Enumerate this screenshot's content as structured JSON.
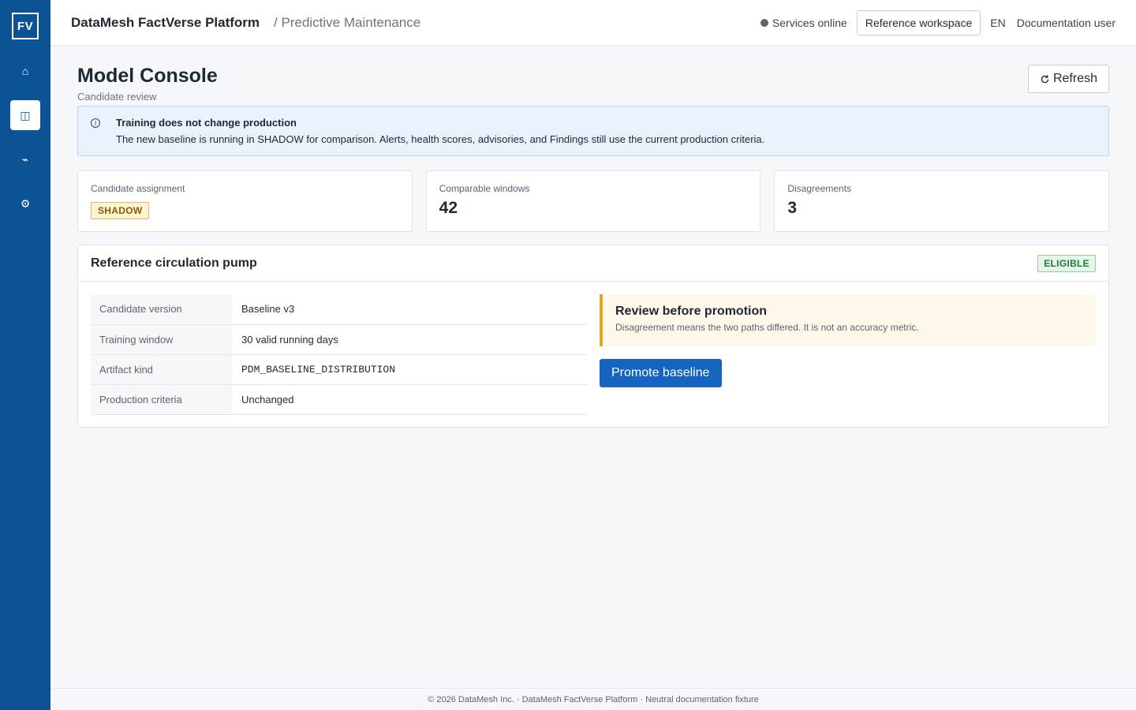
{
  "sidebar": {
    "logo": "FV",
    "items": [
      {
        "icon": "home-icon",
        "glyph": "⌂"
      },
      {
        "icon": "model-console-icon",
        "glyph": "◫"
      },
      {
        "icon": "signal-icon",
        "glyph": "⌁"
      },
      {
        "icon": "gear-icon",
        "glyph": "⚙"
      }
    ],
    "active_color": "#0b5394"
  },
  "header": {
    "brand": "DataMesh FactVerse Platform",
    "breadcrumb": "/ Predictive Maintenance",
    "status": "Services online",
    "workspace_button": "Reference workspace",
    "language": "EN",
    "user": "Documentation user"
  },
  "page": {
    "title": "Model Console",
    "subtitle": "Candidate review",
    "refresh_label": "Refresh"
  },
  "info": {
    "title": "Training does not change production",
    "text": "The new baseline is running in SHADOW for comparison. Alerts, health scores, advisories, and Findings still use the current production criteria."
  },
  "cards": {
    "assignment": {
      "label": "Candidate assignment",
      "badge": "SHADOW"
    },
    "windows": {
      "label": "Comparable windows",
      "value": "42"
    },
    "disagreements": {
      "label": "Disagreements",
      "value": "3"
    }
  },
  "panel": {
    "title": "Reference circulation pump",
    "badge": "ELIGIBLE",
    "rows": [
      {
        "key": "Candidate version",
        "value": "Baseline v3"
      },
      {
        "key": "Training window",
        "value": "30 valid running days"
      },
      {
        "key": "Artifact kind",
        "value": "PDM_BASELINE_DISTRIBUTION"
      },
      {
        "key": "Production criteria",
        "value": "Unchanged"
      }
    ],
    "warning": {
      "title": "Review before promotion",
      "text": "Disagreement means the two paths differed. It is not an accuracy metric."
    },
    "promote_label": "Promote baseline"
  },
  "footer": {
    "text": "© 2026 DataMesh Inc. · DataMesh FactVerse Platform · Neutral documentation fixture"
  },
  "colors": {
    "brand_blue": "#0b5394",
    "primary_button": "#1565c0",
    "shadow_badge": "#fdf3d6",
    "eligible_badge": "#e6f5ea",
    "warning_accent": "#e0a526"
  }
}
